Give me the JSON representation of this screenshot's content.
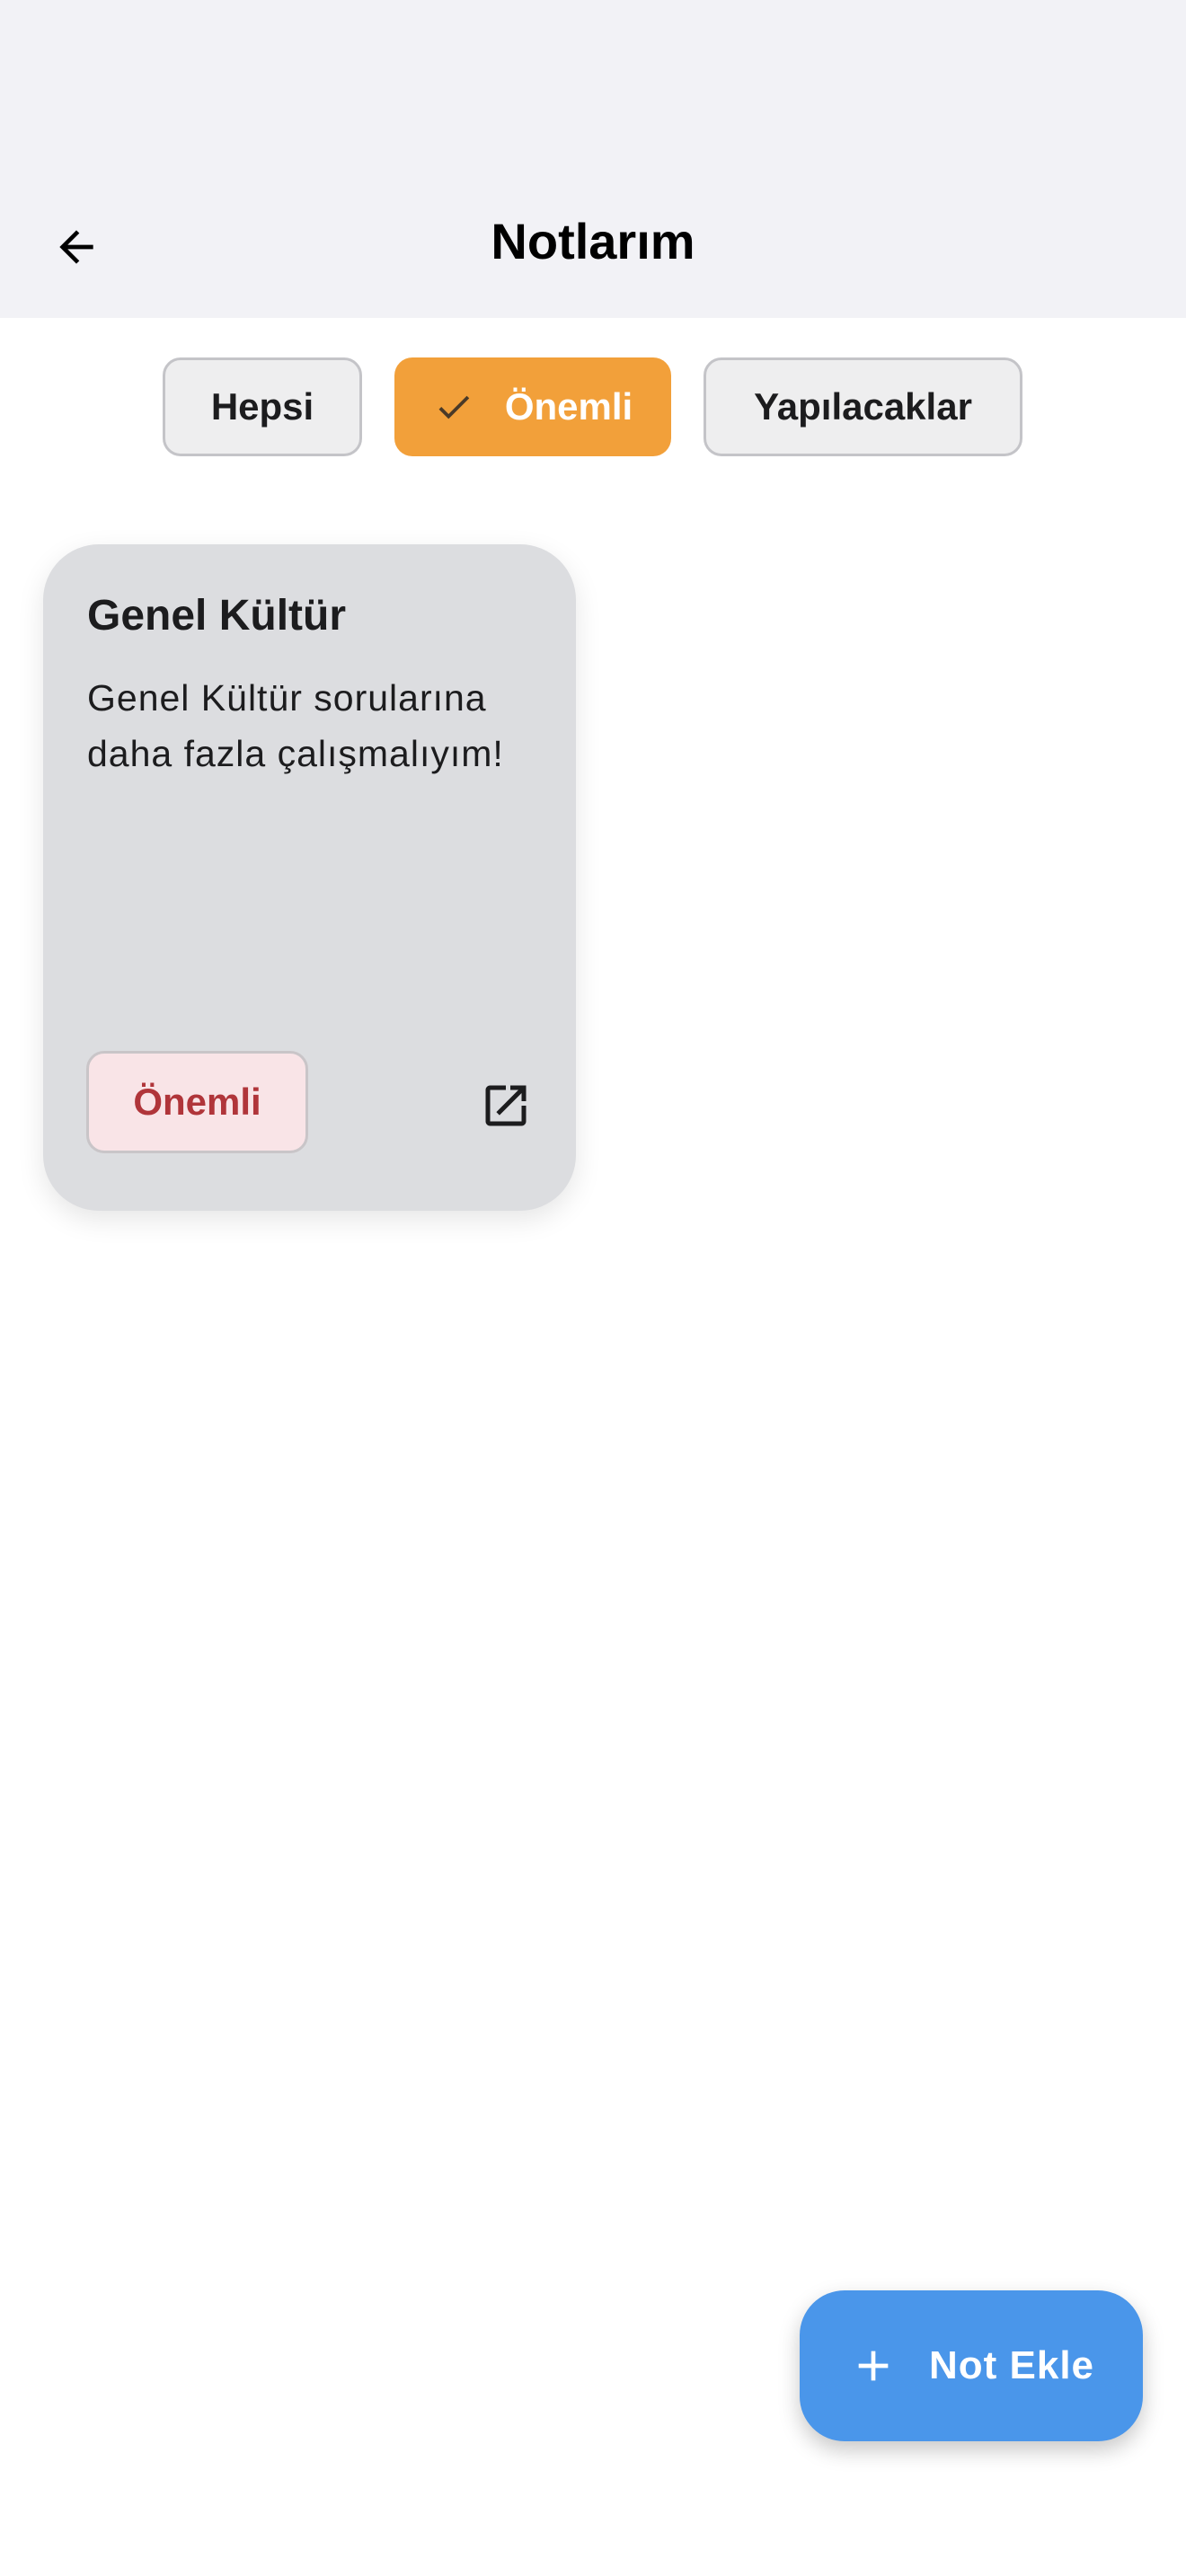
{
  "header": {
    "title": "Notlarım",
    "back_icon": "arrow-left-icon"
  },
  "filters": {
    "items": [
      {
        "label": "Hepsi",
        "selected": false
      },
      {
        "label": "Önemli",
        "selected": true,
        "icon": "check-icon"
      },
      {
        "label": "Yapılacaklar",
        "selected": false
      }
    ]
  },
  "notes": [
    {
      "title": "Genel Kültür",
      "body": "Genel Kültür sorularına daha fazla çalışmalıyım!",
      "tag": "Önemli",
      "action_icon": "open-in-new-icon"
    }
  ],
  "fab": {
    "label": "Not Ekle",
    "icon": "plus-icon"
  },
  "colors": {
    "app_bar_bg": "#f2f2f6",
    "chip_active": "#f2a03a",
    "chip_inactive": "#eeeeef",
    "card_bg": "#dcdde0",
    "tag_bg": "#f9e4e7",
    "tag_text": "#b0353a",
    "fab_bg": "#4a96ea"
  }
}
